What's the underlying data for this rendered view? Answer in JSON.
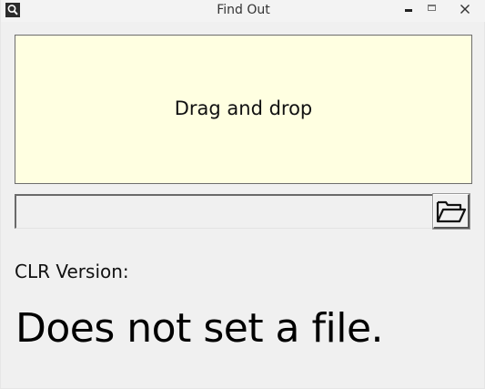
{
  "window": {
    "title": "Find Out",
    "app_icon": "magnifier-icon",
    "controls": {
      "minimize_icon": "minimize-icon",
      "maximize_icon": "maximize-icon",
      "close_icon": "close-icon"
    }
  },
  "dropzone": {
    "label": "Drag and drop",
    "background_color": "#ffffe1"
  },
  "path_input": {
    "value": "",
    "placeholder": ""
  },
  "browse_button": {
    "icon": "open-folder-icon"
  },
  "clr": {
    "label": "CLR Version:",
    "status": "Does not set a file."
  }
}
